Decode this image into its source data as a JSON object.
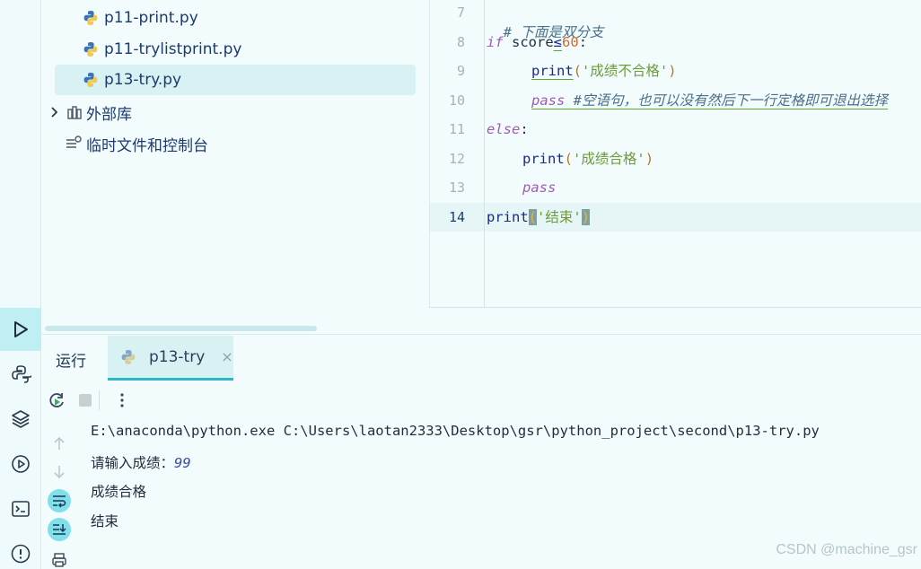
{
  "project_tree": {
    "files": [
      {
        "label": "p11-print.py",
        "selected": false
      },
      {
        "label": "p11-trylistprint.py",
        "selected": false
      },
      {
        "label": "p13-try.py",
        "selected": true
      }
    ],
    "external_libs": "外部库",
    "scratches": "临时文件和控制台"
  },
  "editor": {
    "line_numbers": [
      "7",
      "8",
      "9",
      "10",
      "11",
      "12",
      "13",
      "14"
    ],
    "current_line": "14",
    "lines": {
      "l7_comment": "# 下面是双分支",
      "l8_if": "if",
      "l8_var": " score",
      "l8_op": "≤",
      "l8_num": "60",
      "l8_colon": ":",
      "l9_print": "print",
      "l9_open": "(",
      "l9_str": "'成绩不合格'",
      "l9_close": ")",
      "l10_pass": "pass",
      "l10_comment": " #空语句，也可以没有然后下一行定格即可退出选择",
      "l11_else": "else",
      "l11_colon": ":",
      "l12_print": "print",
      "l12_open": "(",
      "l12_str": "'成绩合格'",
      "l12_close": ")",
      "l13_pass": "pass",
      "l14_print": "print",
      "l14_open": "(",
      "l14_str": "'结束'",
      "l14_close": ")"
    }
  },
  "run_panel": {
    "title": "运行",
    "tab_label": "p13-try",
    "tab_close": "×",
    "output": {
      "command": "E:\\anaconda\\python.exe C:\\Users\\laotan2333\\Desktop\\gsr\\python_project\\second\\p13-try.py",
      "prompt": "请输入成绩：",
      "input_value": "99",
      "line3": "成绩合格",
      "line4": "结束"
    }
  },
  "watermark": "CSDN @machine_gsr"
}
